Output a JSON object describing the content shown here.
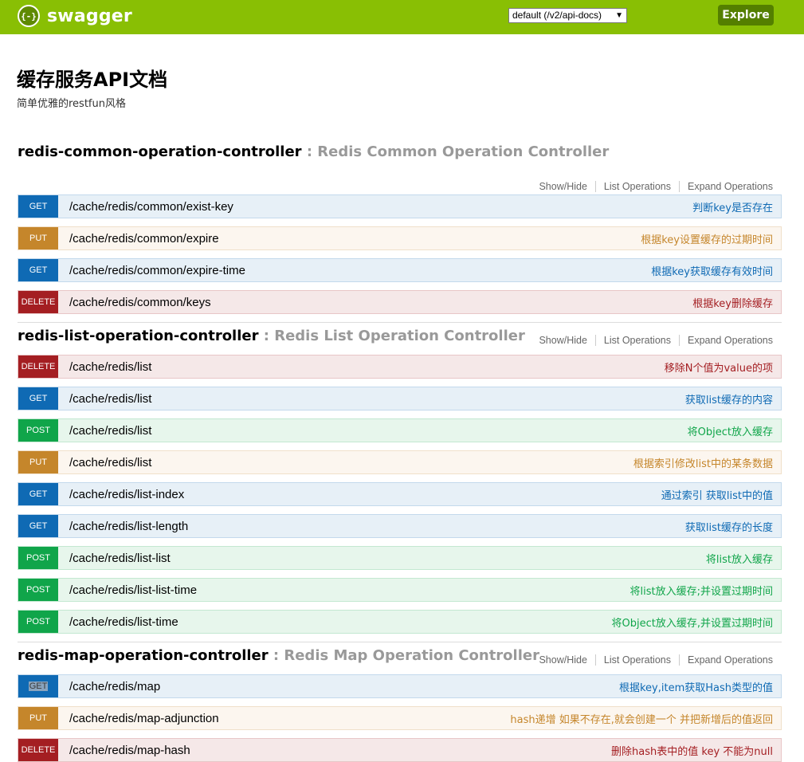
{
  "header": {
    "logo_icon": "{-}",
    "logo_text": "swagger",
    "api_select": "default (/v2/api-docs)",
    "explore_label": "Explore",
    "bar_color": "#89bf04"
  },
  "info": {
    "title": "缓存服务API文档",
    "description": "简单优雅的restfun风格"
  },
  "resource_actions": {
    "show_hide": "Show/Hide",
    "list": "List Operations",
    "expand": "Expand Operations"
  },
  "method_colors": {
    "GET": "#0f6ab4",
    "PUT": "#c5862b",
    "POST": "#10a54a",
    "DELETE": "#a41e22"
  },
  "resources": [
    {
      "name": "redis-common-operation-controller",
      "separator": " : ",
      "description": "Redis Common Operation Controller",
      "operations": [
        {
          "method": "GET",
          "path": "/cache/redis/common/exist-key",
          "summary": "判断key是否存在"
        },
        {
          "method": "PUT",
          "path": "/cache/redis/common/expire",
          "summary": "根据key设置缓存的过期时间"
        },
        {
          "method": "GET",
          "path": "/cache/redis/common/expire-time",
          "summary": "根据key获取缓存有效时间"
        },
        {
          "method": "DELETE",
          "path": "/cache/redis/common/keys",
          "summary": "根据key删除缓存"
        }
      ]
    },
    {
      "name": "redis-list-operation-controller",
      "separator": " : ",
      "description": "Redis List Operation Controller",
      "operations": [
        {
          "method": "DELETE",
          "path": "/cache/redis/list",
          "summary": "移除N个值为value的项"
        },
        {
          "method": "GET",
          "path": "/cache/redis/list",
          "summary": "获取list缓存的内容"
        },
        {
          "method": "POST",
          "path": "/cache/redis/list",
          "summary": "将Object放入缓存"
        },
        {
          "method": "PUT",
          "path": "/cache/redis/list",
          "summary": "根据索引修改list中的某条数据"
        },
        {
          "method": "GET",
          "path": "/cache/redis/list-index",
          "summary": "通过索引 获取list中的值"
        },
        {
          "method": "GET",
          "path": "/cache/redis/list-length",
          "summary": "获取list缓存的长度"
        },
        {
          "method": "POST",
          "path": "/cache/redis/list-list",
          "summary": "将list放入缓存"
        },
        {
          "method": "POST",
          "path": "/cache/redis/list-list-time",
          "summary": "将list放入缓存;并设置过期时间"
        },
        {
          "method": "POST",
          "path": "/cache/redis/list-time",
          "summary": "将Object放入缓存,并设置过期时间"
        }
      ]
    },
    {
      "name": "redis-map-operation-controller",
      "separator": " : ",
      "description": "Redis Map Operation Controller",
      "operations": [
        {
          "method": "GET",
          "path": "/cache/redis/map",
          "summary": "根据key,item获取Hash类型的值"
        },
        {
          "method": "PUT",
          "path": "/cache/redis/map-adjunction",
          "summary": "hash递增 如果不存在,就会创建一个 并把新增后的值返回"
        },
        {
          "method": "DELETE",
          "path": "/cache/redis/map-hash",
          "summary": "删除hash表中的值 key 不能为null"
        }
      ]
    }
  ]
}
